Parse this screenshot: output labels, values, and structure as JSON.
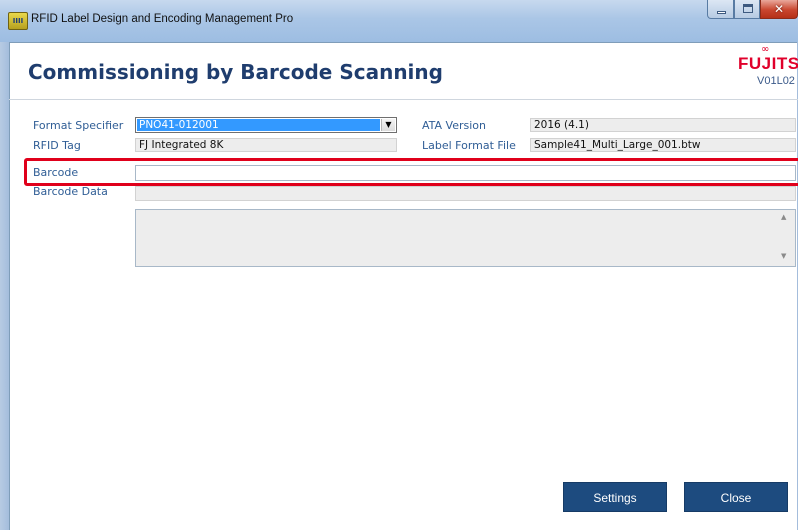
{
  "window": {
    "title": "RFID Label Design and Encoding Management Pro",
    "app_icon": "app-icon"
  },
  "header": {
    "page_title": "Commissioning by Barcode Scanning",
    "logo_text": "FUJITSU",
    "version": "V01L02",
    "logo_color": "#e0002b"
  },
  "form": {
    "format_specifier": {
      "label": "Format Specifier",
      "value": "PNO41-012001"
    },
    "rfid_tag": {
      "label": "RFID Tag",
      "value": "FJ Integrated 8K"
    },
    "ata_version": {
      "label": "ATA Version",
      "value": "2016 (4.1)"
    },
    "label_format_file": {
      "label": "Label Format File",
      "value": "Sample41_Multi_Large_001.btw"
    },
    "barcode": {
      "label": "Barcode",
      "value": ""
    },
    "barcode_data": {
      "label": "Barcode Data",
      "value": ""
    }
  },
  "buttons": {
    "settings": "Settings",
    "close": "Close"
  },
  "colors": {
    "accent": "#1d4b7f",
    "label": "#2f5d95",
    "highlight": "#e0001b",
    "selection": "#3399ff"
  }
}
